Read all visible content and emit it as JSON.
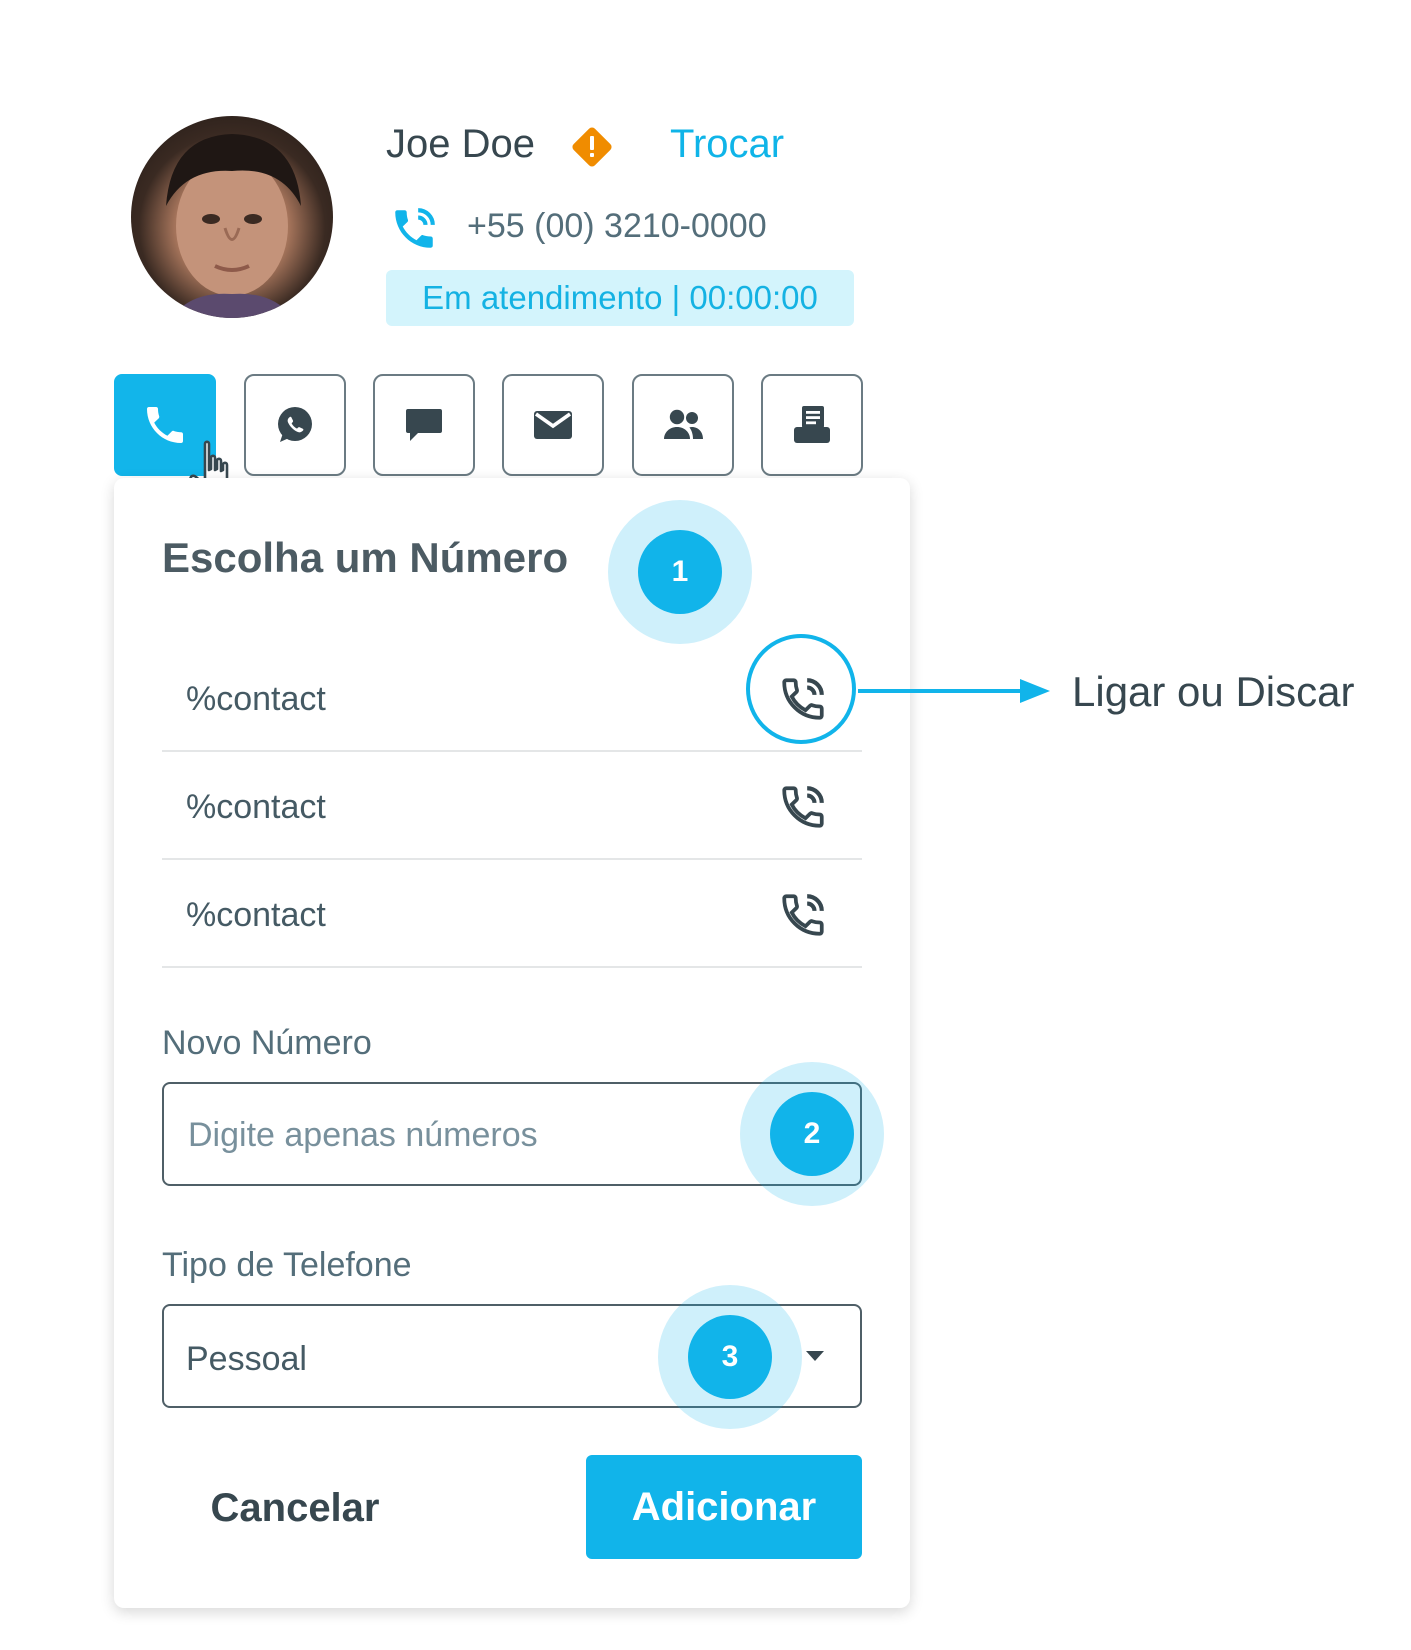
{
  "contact": {
    "name": "Joe Doe",
    "swap_label": "Trocar",
    "phone": "+55 (00) 3210-0000",
    "status": "Em atendimento | 00:00:00"
  },
  "tabs": [
    {
      "name": "phone",
      "active": true
    },
    {
      "name": "whatsapp",
      "active": false
    },
    {
      "name": "chat",
      "active": false
    },
    {
      "name": "email",
      "active": false
    },
    {
      "name": "contacts",
      "active": false
    },
    {
      "name": "fax",
      "active": false
    }
  ],
  "panel": {
    "title": "Escolha um Número",
    "numbers": [
      "%contact",
      "%contact",
      "%contact"
    ],
    "new_number_label": "Novo Número",
    "new_number_placeholder": "Digite apenas números",
    "phone_type_label": "Tipo de Telefone",
    "phone_type_value": "Pessoal",
    "cancel_label": "Cancelar",
    "add_label": "Adicionar"
  },
  "annotations": {
    "call_label": "Ligar ou Discar",
    "badges": [
      "1",
      "2",
      "3"
    ]
  },
  "colors": {
    "accent": "#11b4ea",
    "warning": "#f08c00",
    "status_bg": "#d3f4fc"
  }
}
